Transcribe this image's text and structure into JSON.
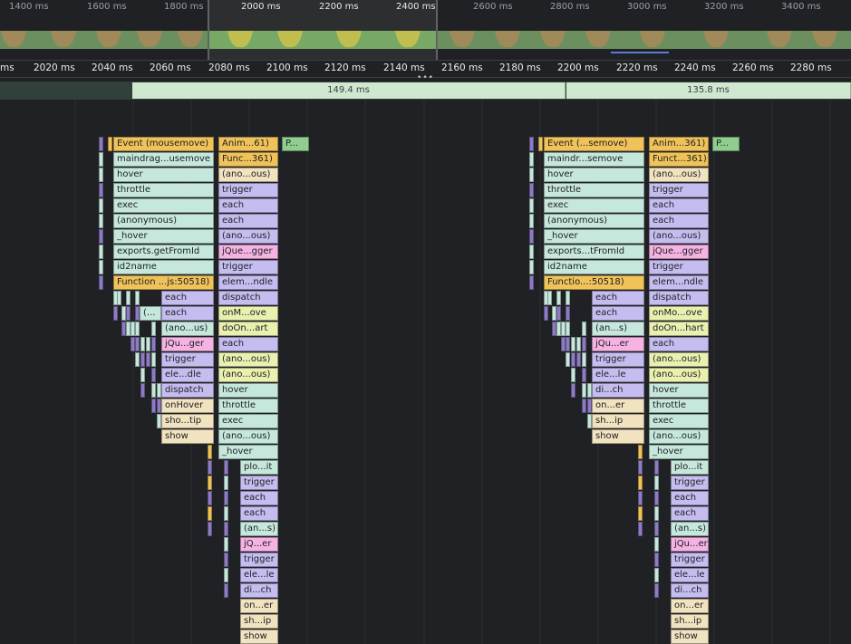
{
  "overview": {
    "ticks": [
      "1400 ms",
      "1600 ms",
      "1800 ms",
      "2000 ms",
      "2200 ms",
      "2400 ms",
      "2600 ms",
      "2800 ms",
      "3000 ms",
      "3200 ms",
      "3400 ms"
    ]
  },
  "ruler": {
    "ticks": [
      "ms",
      "2020 ms",
      "2040 ms",
      "2060 ms",
      "2080 ms",
      "2100 ms",
      "2120 ms",
      "2140 ms",
      "2160 ms",
      "2180 ms",
      "2200 ms",
      "2220 ms",
      "2240 ms",
      "2260 ms",
      "2280 ms"
    ]
  },
  "frames": [
    {
      "label": "149.4 ms"
    },
    {
      "label": "135.8 ms"
    }
  ],
  "colors": {
    "event": "#f0c35a",
    "script": "#c6e8dc",
    "purple": "#c5bdf0",
    "pink": "#f5b3e3",
    "yellow": "#eaf0b0",
    "tan": "#f1e2c0",
    "green": "#8fce8f",
    "grid": "#2f3033"
  },
  "flame": {
    "left": {
      "col1": [
        "Event (mousemove)",
        "maindrag...usemove",
        "hover",
        "throttle",
        "exec",
        "(anonymous)",
        "_hover",
        "exports.getFromId",
        "id2name",
        "Function ...js:50518)"
      ],
      "col1b": [
        "each",
        "each",
        "(ano...us)",
        "jQu...ger",
        "trigger",
        "ele...dle",
        "dispatch",
        "onHover",
        "sho...tip",
        "show"
      ],
      "col1c": [
        "(..."
      ],
      "col2": [
        "Anim...61)",
        "Func...361)",
        "(ano...ous)",
        "trigger",
        "each",
        "each",
        "(ano...ous)",
        "jQue...gger",
        "trigger",
        "elem...ndle",
        "dispatch",
        "onM...ove",
        "doOn...art",
        "each",
        "(ano...ous)",
        "(ano...ous)",
        "hover",
        "throttle",
        "exec",
        "(ano...ous)",
        "_hover"
      ],
      "col2b": [
        "plo...it",
        "trigger",
        "each",
        "each",
        "(an...s)",
        "jQ...er",
        "trigger",
        "ele...le",
        "di...ch",
        "on...er",
        "sh...ip",
        "show"
      ],
      "col3": [
        "P..."
      ]
    },
    "right": {
      "col1": [
        "Event (...semove)",
        "maindr...semove",
        "hover",
        "throttle",
        "exec",
        "(anonymous)",
        "_hover",
        "exports...tFromId",
        "id2name",
        "Functio...:50518)"
      ],
      "col1b": [
        "each",
        "each",
        "(an...s)",
        "jQu...er",
        "trigger",
        "ele...le",
        "di...ch",
        "on...er",
        "sh...ip",
        "show"
      ],
      "col2": [
        "Anim...361)",
        "Funct...361)",
        "(ano...ous)",
        "trigger",
        "each",
        "each",
        "(ano...ous)",
        "jQue...gger",
        "trigger",
        "elem...ndle",
        "dispatch",
        "onMo...ove",
        "doOn...hart",
        "each",
        "(ano...ous)",
        "(ano...ous)",
        "hover",
        "throttle",
        "exec",
        "(ano...ous)",
        "_hover"
      ],
      "col2b": [
        "plo...it",
        "trigger",
        "each",
        "each",
        "(an...s)",
        "jQu...er",
        "trigger",
        "ele...le",
        "di...ch",
        "on...er",
        "sh...ip",
        "show"
      ],
      "col3": [
        "P..."
      ]
    }
  }
}
